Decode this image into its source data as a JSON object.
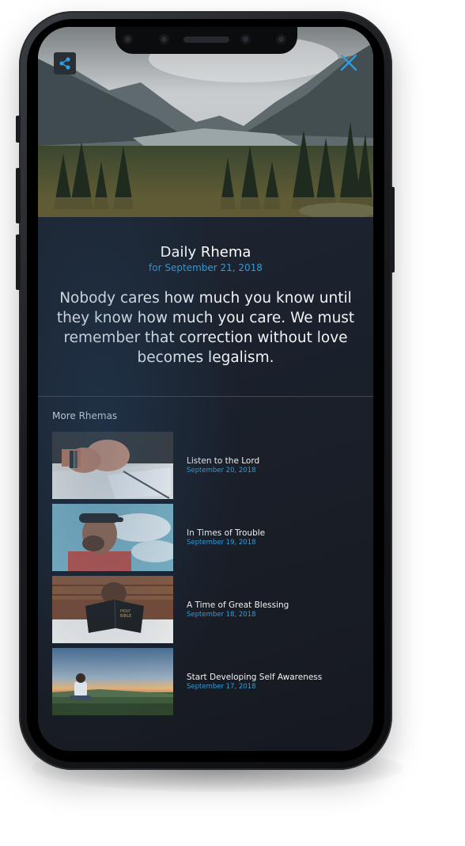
{
  "header": {
    "share_icon": "share-icon",
    "close_icon": "close-icon"
  },
  "rhema": {
    "title": "Daily Rhema",
    "date": "for September 21, 2018",
    "quote": "Nobody cares how much you know until they know how much you care. We must remember that correction without love becomes legalism."
  },
  "more": {
    "heading": "More Rhemas",
    "items": [
      {
        "title": "Listen to the Lord",
        "date": "September 20, 2018"
      },
      {
        "title": "In Times of Trouble",
        "date": "September 19, 2018"
      },
      {
        "title": "A Time of Great Blessing",
        "date": "September 18, 2018"
      },
      {
        "title": "Start Developing Self Awareness",
        "date": "September 17, 2018"
      }
    ]
  },
  "colors": {
    "accent": "#2d9ee0",
    "background": "#1c2430",
    "text": "#ffffff"
  }
}
